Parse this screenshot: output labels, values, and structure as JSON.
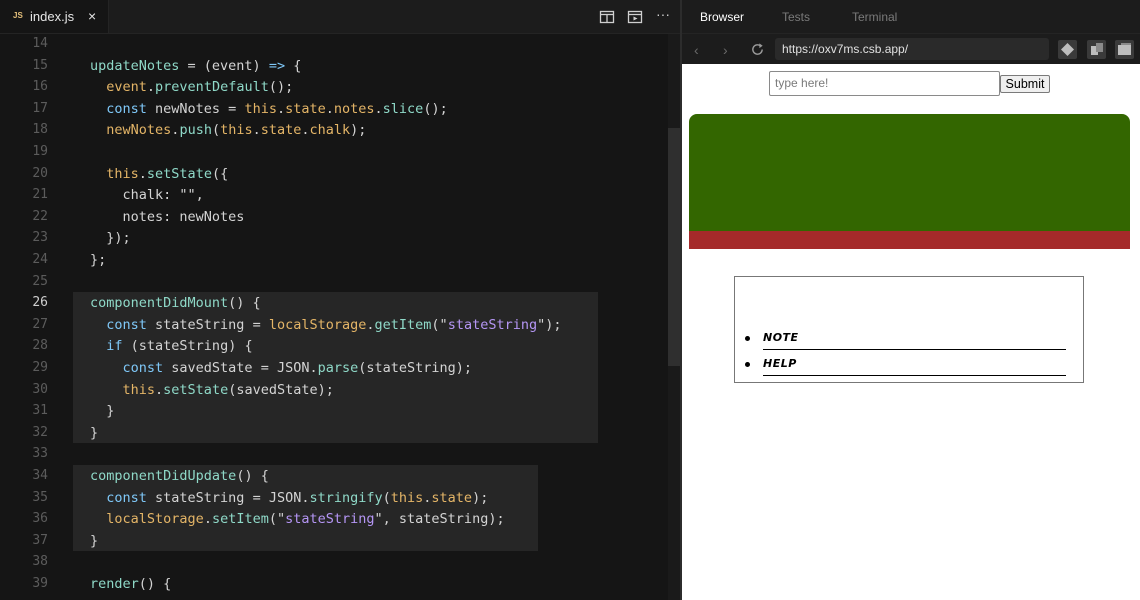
{
  "editor": {
    "tab_icon": "JS",
    "tab_name": "index.js",
    "tab_close": "×",
    "more_label": "···",
    "active_line": 26,
    "lines": [
      {
        "n": 14,
        "tokens": []
      },
      {
        "n": 15,
        "tokens": [
          {
            "t": "fn",
            "v": "updateNotes"
          },
          {
            "t": "pl",
            "v": " = (event) "
          },
          {
            "t": "op",
            "v": "=>"
          },
          {
            "t": "pl",
            "v": " {"
          }
        ]
      },
      {
        "n": 16,
        "tokens": [
          {
            "t": "pl",
            "v": "  "
          },
          {
            "t": "prop",
            "v": "event"
          },
          {
            "t": "pl",
            "v": "."
          },
          {
            "t": "meth",
            "v": "preventDefault"
          },
          {
            "t": "pl",
            "v": "();"
          }
        ]
      },
      {
        "n": 17,
        "tokens": [
          {
            "t": "pl",
            "v": "  "
          },
          {
            "t": "kw",
            "v": "const"
          },
          {
            "t": "pl",
            "v": " newNotes = "
          },
          {
            "t": "this",
            "v": "this"
          },
          {
            "t": "pl",
            "v": "."
          },
          {
            "t": "prop",
            "v": "state"
          },
          {
            "t": "pl",
            "v": "."
          },
          {
            "t": "prop",
            "v": "notes"
          },
          {
            "t": "pl",
            "v": "."
          },
          {
            "t": "meth",
            "v": "slice"
          },
          {
            "t": "pl",
            "v": "();"
          }
        ]
      },
      {
        "n": 18,
        "tokens": [
          {
            "t": "pl",
            "v": "  "
          },
          {
            "t": "prop",
            "v": "newNotes"
          },
          {
            "t": "pl",
            "v": "."
          },
          {
            "t": "meth",
            "v": "push"
          },
          {
            "t": "pl",
            "v": "("
          },
          {
            "t": "this",
            "v": "this"
          },
          {
            "t": "pl",
            "v": "."
          },
          {
            "t": "prop",
            "v": "state"
          },
          {
            "t": "pl",
            "v": "."
          },
          {
            "t": "prop",
            "v": "chalk"
          },
          {
            "t": "pl",
            "v": ");"
          }
        ]
      },
      {
        "n": 19,
        "tokens": []
      },
      {
        "n": 20,
        "tokens": [
          {
            "t": "pl",
            "v": "  "
          },
          {
            "t": "this",
            "v": "this"
          },
          {
            "t": "pl",
            "v": "."
          },
          {
            "t": "meth",
            "v": "setState"
          },
          {
            "t": "pl",
            "v": "({"
          }
        ]
      },
      {
        "n": 21,
        "tokens": [
          {
            "t": "pl",
            "v": "    chalk: \"\","
          }
        ]
      },
      {
        "n": 22,
        "tokens": [
          {
            "t": "pl",
            "v": "    notes: newNotes"
          }
        ]
      },
      {
        "n": 23,
        "tokens": [
          {
            "t": "pl",
            "v": "  });"
          }
        ]
      },
      {
        "n": 24,
        "tokens": [
          {
            "t": "pl",
            "v": "};"
          }
        ]
      },
      {
        "n": 25,
        "tokens": []
      },
      {
        "n": 26,
        "tokens": [
          {
            "t": "fn",
            "v": "componentDidMount"
          },
          {
            "t": "pl",
            "v": "() {"
          }
        ]
      },
      {
        "n": 27,
        "tokens": [
          {
            "t": "pl",
            "v": "  "
          },
          {
            "t": "kw",
            "v": "const"
          },
          {
            "t": "pl",
            "v": " stateString = "
          },
          {
            "t": "builtin",
            "v": "localStorage"
          },
          {
            "t": "pl",
            "v": "."
          },
          {
            "t": "meth",
            "v": "getItem"
          },
          {
            "t": "pl",
            "v": "(\""
          },
          {
            "t": "str",
            "v": "stateString"
          },
          {
            "t": "pl",
            "v": "\");"
          }
        ]
      },
      {
        "n": 28,
        "tokens": [
          {
            "t": "pl",
            "v": "  "
          },
          {
            "t": "kw",
            "v": "if"
          },
          {
            "t": "pl",
            "v": " (stateString) {"
          }
        ]
      },
      {
        "n": 29,
        "tokens": [
          {
            "t": "pl",
            "v": "    "
          },
          {
            "t": "kw",
            "v": "const"
          },
          {
            "t": "pl",
            "v": " savedState = JSON."
          },
          {
            "t": "meth",
            "v": "parse"
          },
          {
            "t": "pl",
            "v": "(stateString);"
          }
        ]
      },
      {
        "n": 30,
        "tokens": [
          {
            "t": "pl",
            "v": "    "
          },
          {
            "t": "this",
            "v": "this"
          },
          {
            "t": "pl",
            "v": "."
          },
          {
            "t": "meth",
            "v": "setState"
          },
          {
            "t": "pl",
            "v": "(savedState);"
          }
        ]
      },
      {
        "n": 31,
        "tokens": [
          {
            "t": "pl",
            "v": "  }"
          }
        ]
      },
      {
        "n": 32,
        "tokens": [
          {
            "t": "pl",
            "v": "}"
          }
        ]
      },
      {
        "n": 33,
        "tokens": []
      },
      {
        "n": 34,
        "tokens": [
          {
            "t": "fn",
            "v": "componentDidUpdate"
          },
          {
            "t": "pl",
            "v": "() {"
          }
        ]
      },
      {
        "n": 35,
        "tokens": [
          {
            "t": "pl",
            "v": "  "
          },
          {
            "t": "kw",
            "v": "const"
          },
          {
            "t": "pl",
            "v": " stateString = JSON."
          },
          {
            "t": "meth",
            "v": "stringify"
          },
          {
            "t": "pl",
            "v": "("
          },
          {
            "t": "this",
            "v": "this"
          },
          {
            "t": "pl",
            "v": "."
          },
          {
            "t": "prop",
            "v": "state"
          },
          {
            "t": "pl",
            "v": ");"
          }
        ]
      },
      {
        "n": 36,
        "tokens": [
          {
            "t": "pl",
            "v": "  "
          },
          {
            "t": "builtin",
            "v": "localStorage"
          },
          {
            "t": "pl",
            "v": "."
          },
          {
            "t": "meth",
            "v": "setItem"
          },
          {
            "t": "pl",
            "v": "(\""
          },
          {
            "t": "str",
            "v": "stateString"
          },
          {
            "t": "pl",
            "v": "\", stateString);"
          }
        ]
      },
      {
        "n": 37,
        "tokens": [
          {
            "t": "pl",
            "v": "}"
          }
        ]
      },
      {
        "n": 38,
        "tokens": []
      },
      {
        "n": 39,
        "tokens": [
          {
            "t": "fn",
            "v": "render"
          },
          {
            "t": "pl",
            "v": "() {"
          }
        ]
      }
    ]
  },
  "browser": {
    "tabs": [
      "Browser",
      "Tests",
      "Terminal"
    ],
    "active_tab": "Browser",
    "url": "https://oxv7ms.csb.app/",
    "preview": {
      "input_placeholder": "type here!",
      "submit_label": "Submit",
      "board_color": "#336600",
      "tray_color": "#a52a2a",
      "notes": [
        "NOTE",
        "HELP"
      ]
    }
  }
}
